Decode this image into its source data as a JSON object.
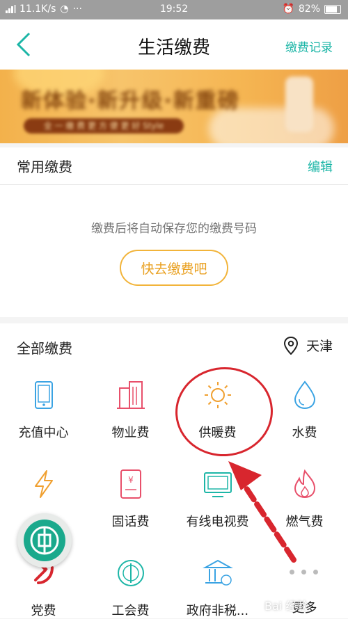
{
  "status_bar": {
    "speed": "11.1K/s",
    "time": "19:52",
    "battery": "82%"
  },
  "nav": {
    "title": "生活缴费",
    "right_link": "缴费记录"
  },
  "banner": {
    "headline": "新体验·新升级·新重磅",
    "sub": "全 一 缴 费 更 方 便 更 好 Style"
  },
  "common": {
    "title": "常用缴费",
    "edit": "编辑",
    "hint": "缴费后将自动保存您的缴费号码",
    "button": "快去缴费吧"
  },
  "all": {
    "title": "全部缴费",
    "city": "天津"
  },
  "items": [
    {
      "label": "充值中心",
      "icon": "phone-icon",
      "color": "#3aa3e3"
    },
    {
      "label": "物业费",
      "icon": "building-icon",
      "color": "#e8506b"
    },
    {
      "label": "供暖费",
      "icon": "sun-icon",
      "color": "#f0a030"
    },
    {
      "label": "水费",
      "icon": "water-drop-icon",
      "color": "#3aa3e3"
    },
    {
      "label": "电费",
      "icon": "lightning-icon",
      "color": "#f0a030"
    },
    {
      "label": "固话费",
      "icon": "landline-icon",
      "color": "#e8506b"
    },
    {
      "label": "有线电视费",
      "icon": "tv-icon",
      "color": "#1db6a7"
    },
    {
      "label": "燃气费",
      "icon": "flame-icon",
      "color": "#e8506b"
    },
    {
      "label": "党费",
      "icon": "party-icon",
      "color": "#d8262e"
    },
    {
      "label": "工会费",
      "icon": "union-icon",
      "color": "#1db6a7"
    },
    {
      "label": "政府非税...",
      "icon": "government-icon",
      "color": "#3aa3e3"
    },
    {
      "label": "更多",
      "icon": "more-icon",
      "color": "#bbbbbb"
    }
  ],
  "watermark": "Bai 经验"
}
